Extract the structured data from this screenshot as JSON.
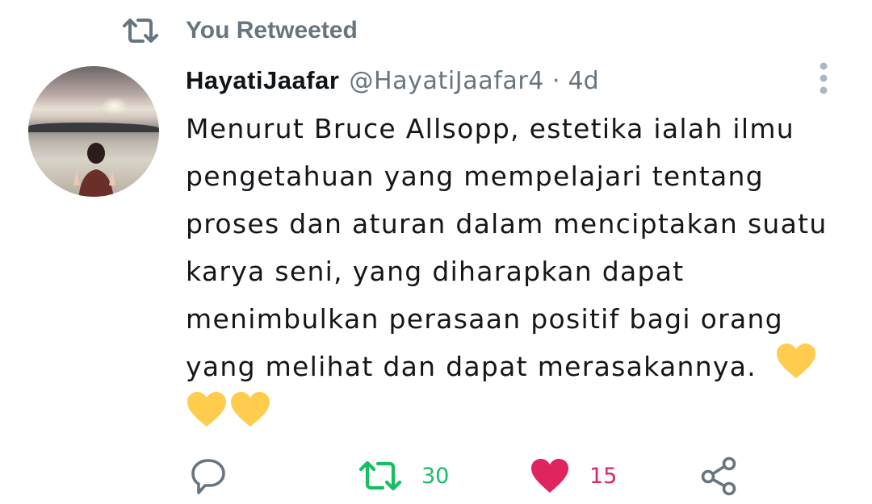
{
  "retweet_banner": {
    "label": "You Retweeted",
    "icon": "retweet-icon"
  },
  "tweet": {
    "display_name": "HayatiJaafar",
    "handle": "@HayatiJaafar4",
    "separator": "·",
    "time": "4d",
    "text": "Menurut Bruce Allsopp, estetika ialah ilmu\npengetahuan yang mempelajari tentang\nproses dan aturan dalam menciptakan suatu\nkarya seni, yang diharapkan dapat\nmenimbulkan perasaan positif bagi orang\nyang melihat dan dapat merasakannya.",
    "emoji": [
      "yellow-heart",
      "yellow-heart",
      "yellow-heart"
    ]
  },
  "actions": {
    "reply": {
      "icon": "reply-icon"
    },
    "retweet": {
      "icon": "retweet-icon",
      "count": "30",
      "color": "#17bf63"
    },
    "like": {
      "icon": "heart-icon",
      "count": "15",
      "color": "#e0245e"
    },
    "share": {
      "icon": "share-icon"
    }
  },
  "colors": {
    "secondary_text": "#66757f",
    "heart_emoji": "#ffcc4d"
  }
}
